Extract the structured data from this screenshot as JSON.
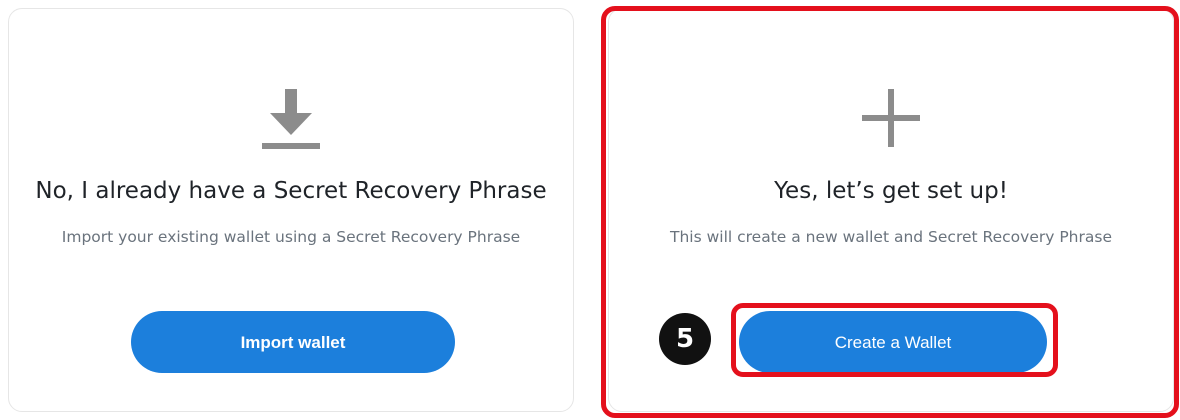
{
  "import_card": {
    "icon": "download-icon",
    "title": "No, I already have a Secret Recovery Phrase",
    "subtitle": "Import your existing wallet using a Secret Recovery Phrase",
    "button_label": "Import wallet"
  },
  "create_card": {
    "icon": "plus-icon",
    "title": "Yes, let’s get set up!",
    "subtitle": "This will create a new wallet and Secret Recovery Phrase",
    "button_label": "Create a Wallet"
  },
  "annotation": {
    "step_number": "5",
    "highlight_color": "#e4101c"
  },
  "colors": {
    "button_blue": "#1c7fdc",
    "icon_gray": "#8c8c8c"
  }
}
